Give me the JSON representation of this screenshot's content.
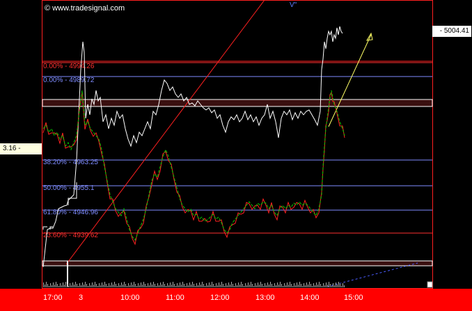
{
  "header": {
    "watermark": "www.tradesignal.com",
    "watermark_icon": "copyright-icon",
    "marker_text": "V\""
  },
  "price_scale": {
    "current_price": "- 5004.41"
  },
  "indicator_scale": {
    "value": "3.16 -"
  },
  "fibonacci_levels": [
    {
      "label": "0.00% - 4994.26",
      "color": "#ff3030",
      "value": 4994.26
    },
    {
      "label": "0.00% - 4989.72",
      "color": "#7f8cff",
      "value": 4989.72
    },
    {
      "label": "38.20% - 4963.25",
      "color": "#7f8cff",
      "value": 4963.25
    },
    {
      "label": "50.00% - 4955.1",
      "color": "#7f8cff",
      "value": 4955.1
    },
    {
      "label": "61.80% - 4946.96",
      "color": "#7f8cff",
      "value": 4946.96
    },
    {
      "label": "23.60% - 4939.62",
      "color": "#ff3030",
      "value": 4939.62
    }
  ],
  "time_axis": {
    "labels": [
      "17:00",
      "3",
      "10:00",
      "11:00",
      "12:00",
      "13:00",
      "14:00",
      "15:00"
    ]
  },
  "colors": {
    "background": "#000000",
    "price_line": "#ffffff",
    "trend_line": "#ff2020",
    "arrow": "#ffff66",
    "fast_line": "#00cc00",
    "slow_line": "#ff2020",
    "axis_bar": "#ff0000",
    "band_fill": "#3a1010",
    "volume": "#aaaaaa"
  }
}
